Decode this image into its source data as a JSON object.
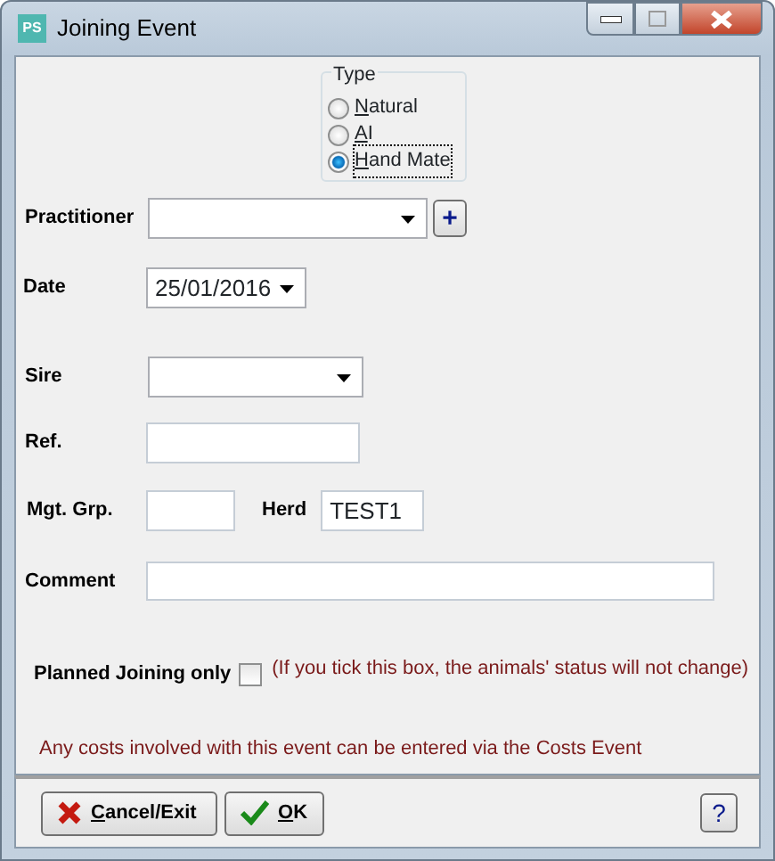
{
  "window": {
    "title": "Joining Event",
    "app_icon": "PS"
  },
  "type_group": {
    "label": "Type",
    "options": [
      {
        "label": "Natural",
        "selected": false
      },
      {
        "label": "AI",
        "selected": false
      },
      {
        "label": "Hand Mate",
        "selected": true
      }
    ]
  },
  "practitioner": {
    "label": "Practitioner",
    "add_button": "+"
  },
  "date": {
    "label": "Date",
    "value": "25/01/2016"
  },
  "sire": {
    "label": "Sire"
  },
  "ref": {
    "label": "Ref."
  },
  "mgt_grp": {
    "label": "Mgt. Grp."
  },
  "herd": {
    "label": "Herd",
    "value": "TEST1"
  },
  "comment": {
    "label": "Comment"
  },
  "planned": {
    "label": "Planned Joining only",
    "checked": false,
    "note": "(If you tick this box, the animals' status will not change)"
  },
  "costs_note": "Any costs involved with this event can be entered via the Costs Event",
  "buttons": [
    {
      "kind": "cancel",
      "label": "Cancel/Exit"
    },
    {
      "kind": "ok",
      "label": "OK"
    },
    {
      "kind": "help",
      "label": "?"
    }
  ]
}
